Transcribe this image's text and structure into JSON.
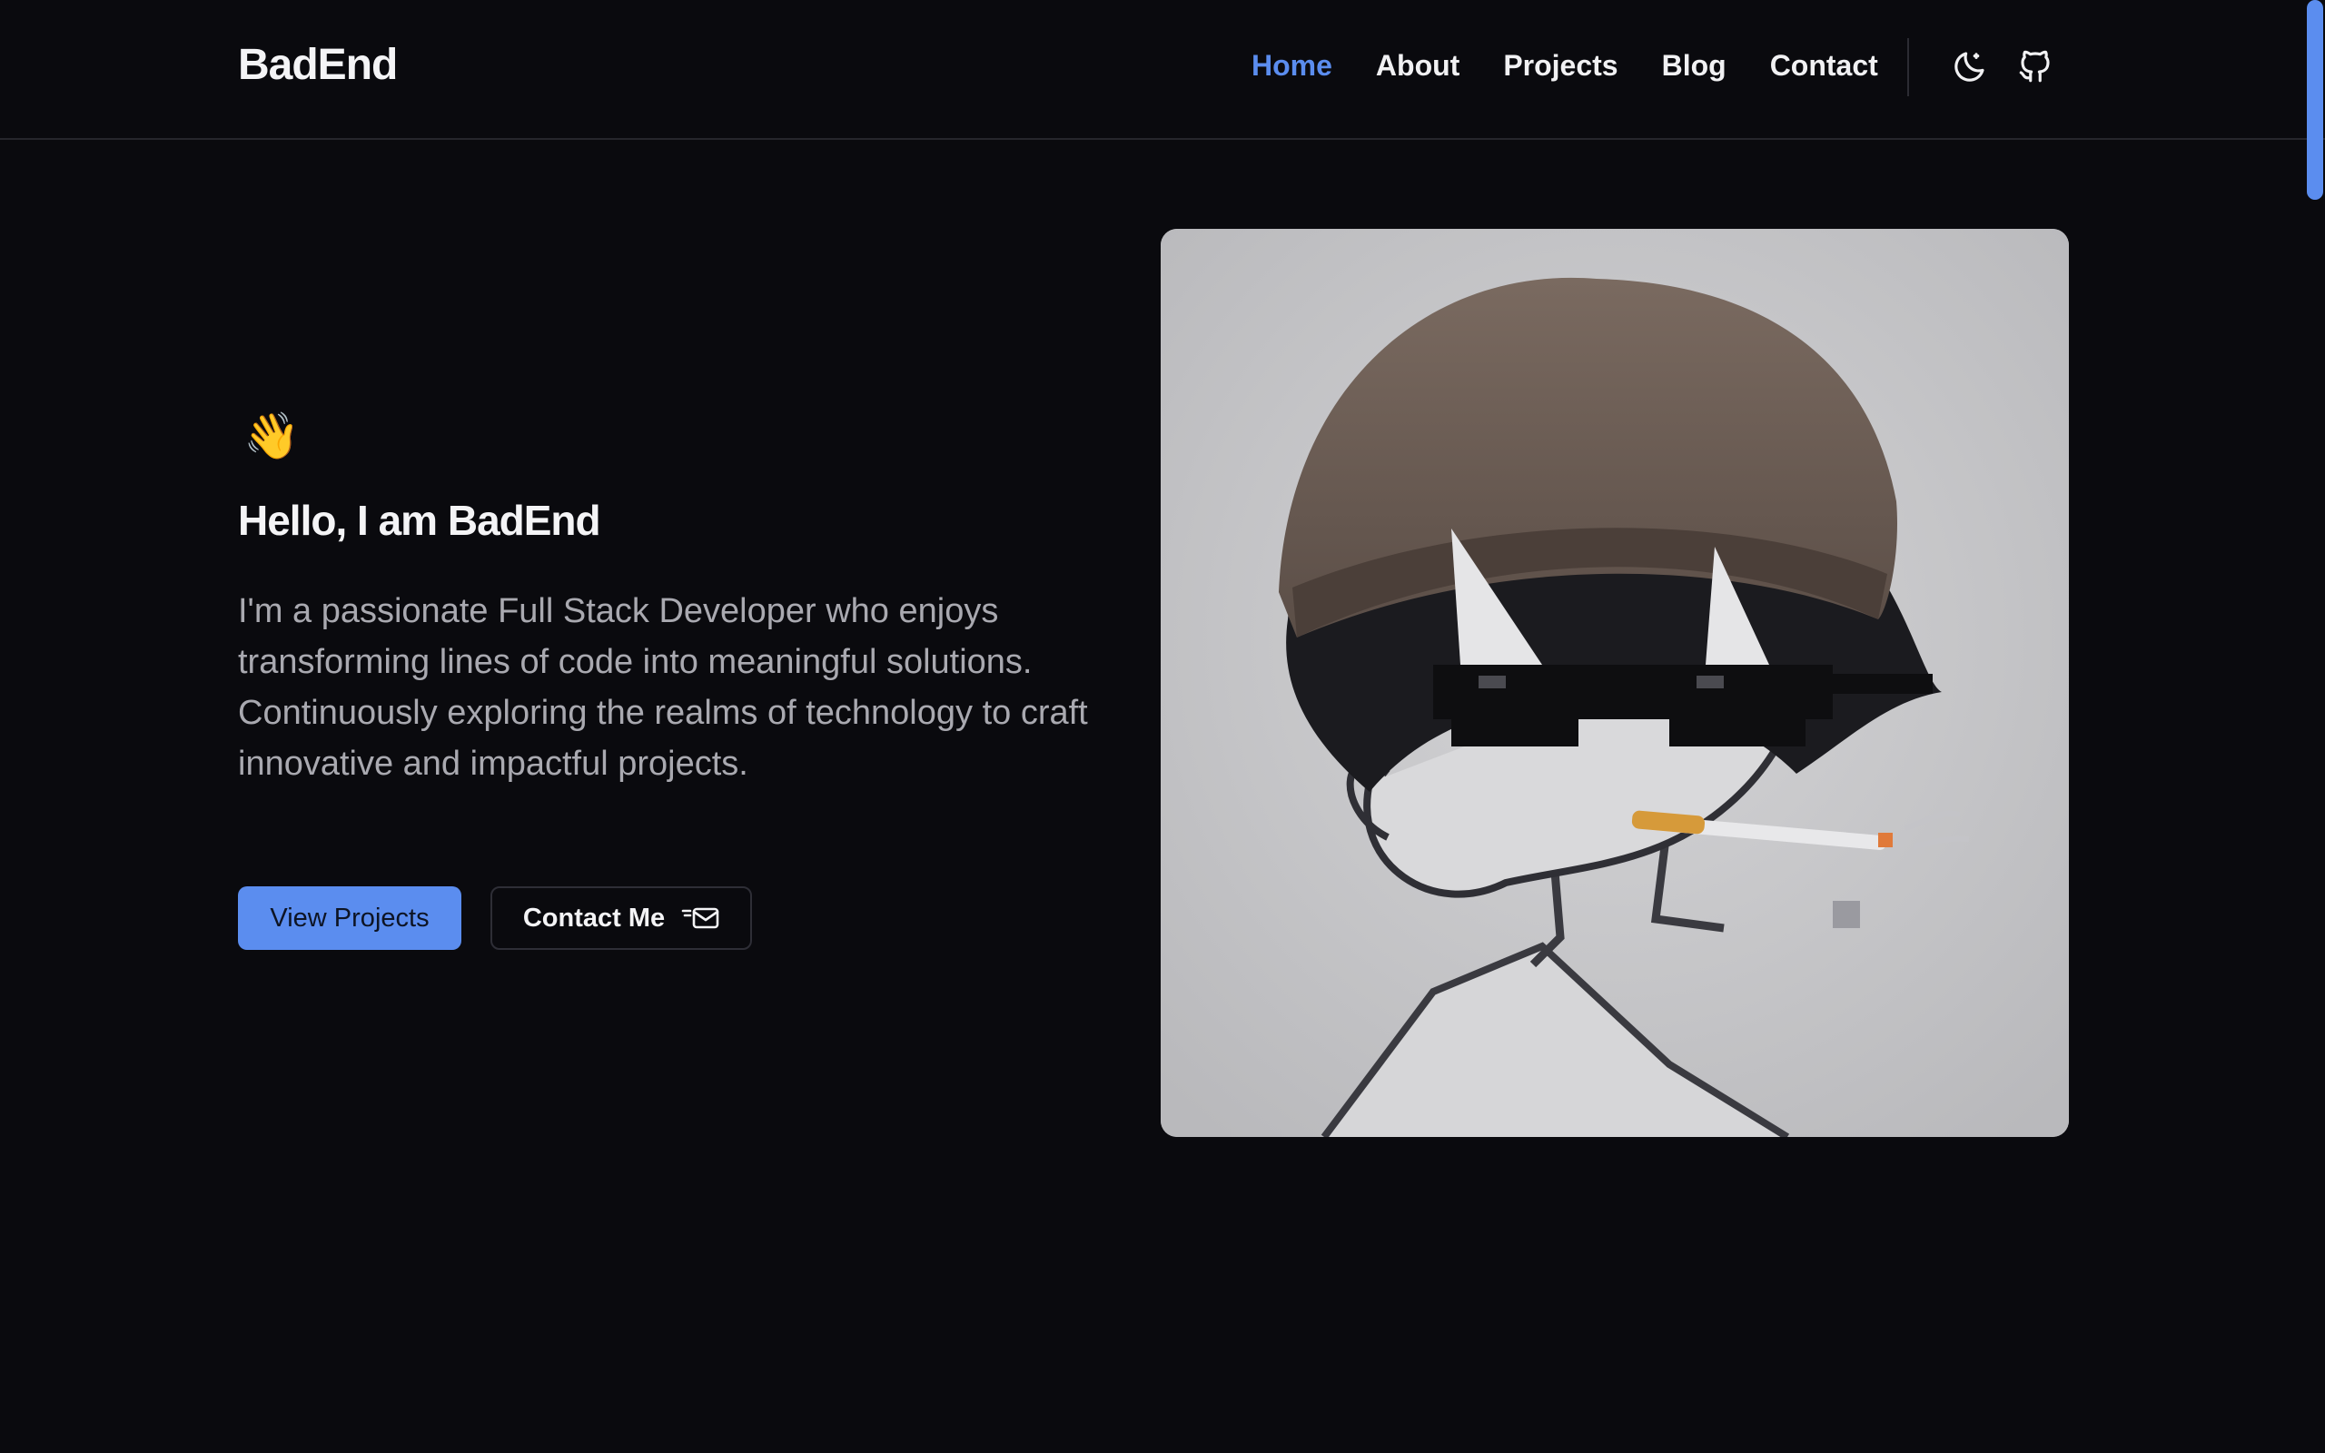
{
  "brand": {
    "name": "BadEnd"
  },
  "nav": {
    "items": [
      {
        "label": "Home",
        "active": true
      },
      {
        "label": "About",
        "active": false
      },
      {
        "label": "Projects",
        "active": false
      },
      {
        "label": "Blog",
        "active": false
      },
      {
        "label": "Contact",
        "active": false
      }
    ],
    "icons": [
      "moon-icon",
      "github-icon"
    ]
  },
  "hero": {
    "wave_emoji": "👋",
    "greeting": "Hello, I am BadEnd",
    "bio": "I'm a passionate Full Stack Developer who enjoys transforming lines of code into meaningful solutions. Continuously exploring the realms of technology to craft innovative and impactful projects.",
    "primary_button": "View Projects",
    "secondary_button": "Contact Me"
  },
  "colors": {
    "background": "#0a0a0e",
    "accent": "#5b8def",
    "text": "#f4f4f6",
    "muted_text": "#a9a9b0"
  }
}
